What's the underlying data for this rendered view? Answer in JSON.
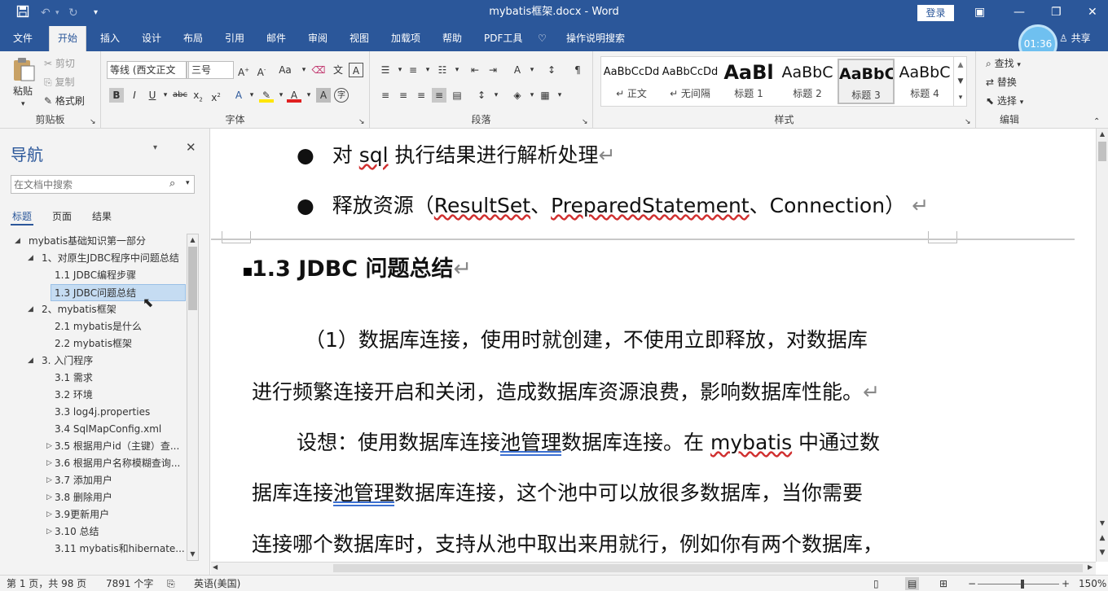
{
  "titlebar": {
    "title": "mybatis框架.docx  -  Word",
    "login": "登录"
  },
  "tabs": [
    "文件",
    "开始",
    "插入",
    "设计",
    "布局",
    "引用",
    "邮件",
    "审阅",
    "视图",
    "加载项",
    "帮助",
    "PDF工具",
    "操作说明搜索"
  ],
  "timer": "01:36",
  "share": "共享",
  "ribbon": {
    "clipboard": {
      "paste": "粘贴",
      "cut": "剪切",
      "copy": "复制",
      "format_painter": "格式刷",
      "label": "剪贴板"
    },
    "font": {
      "name": "等线 (西文正文",
      "size": "三号",
      "aa": "Aa",
      "label": "字体"
    },
    "paragraph": {
      "label": "段落"
    },
    "styles": {
      "label": "样式",
      "items": [
        {
          "preview": "AaBbCcDd",
          "name": "↵ 正文"
        },
        {
          "preview": "AaBbCcDd",
          "name": "↵ 无间隔"
        },
        {
          "preview": "AaBl",
          "name": "标题 1"
        },
        {
          "preview": "AaBbC",
          "name": "标题 2"
        },
        {
          "preview": "AaBbC",
          "name": "标题 3"
        },
        {
          "preview": "AaBbC",
          "name": "标题 4"
        }
      ]
    },
    "editing": {
      "find": "查找",
      "replace": "替换",
      "select": "选择",
      "label": "编辑"
    }
  },
  "nav": {
    "title": "导航",
    "search_placeholder": "在文档中搜索",
    "tabs": [
      "标题",
      "页面",
      "结果"
    ],
    "tree": [
      {
        "label": "mybatis基础知识第一部分",
        "level": 0,
        "toggle": "◢"
      },
      {
        "label": "1、对原生JDBC程序中问题总结",
        "level": 1,
        "toggle": "◢"
      },
      {
        "label": "1.1 JDBC编程步骤",
        "level": 2,
        "toggle": ""
      },
      {
        "label": "1.3 JDBC问题总结",
        "level": 2,
        "toggle": "",
        "selected": true
      },
      {
        "label": "2、mybatis框架",
        "level": 1,
        "toggle": "◢"
      },
      {
        "label": "2.1 mybatis是什么",
        "level": 2,
        "toggle": ""
      },
      {
        "label": "2.2 mybatis框架",
        "level": 2,
        "toggle": ""
      },
      {
        "label": "3. 入门程序",
        "level": 1,
        "toggle": "◢"
      },
      {
        "label": "3.1 需求",
        "level": 2,
        "toggle": ""
      },
      {
        "label": "3.2 环境",
        "level": 2,
        "toggle": ""
      },
      {
        "label": "3.3 log4j.properties",
        "level": 2,
        "toggle": ""
      },
      {
        "label": "3.4 SqlMapConfig.xml",
        "level": 2,
        "toggle": ""
      },
      {
        "label": "3.5 根据用户id（主键）查...",
        "level": 2,
        "toggle": "▷"
      },
      {
        "label": "3.6 根据用户名称模糊查询...",
        "level": 2,
        "toggle": "▷"
      },
      {
        "label": "3.7 添加用户",
        "level": 2,
        "toggle": "▷"
      },
      {
        "label": "3.8 删除用户",
        "level": 2,
        "toggle": "▷"
      },
      {
        "label": "3.9更新用户",
        "level": 2,
        "toggle": "▷"
      },
      {
        "label": "3.10 总结",
        "level": 2,
        "toggle": "▷"
      },
      {
        "label": "3.11 mybatis和hibernate...",
        "level": 2,
        "toggle": ""
      }
    ]
  },
  "doc": {
    "bullet1": {
      "a": "对 ",
      "b": "sql",
      "c": " 执行结果进行解析处理"
    },
    "bullet2": {
      "a": "释放资源（",
      "b": "ResultSet",
      "c": "、",
      "d": "PreparedStatement",
      "e": "、Connection）"
    },
    "heading": "1.3 JDBC 问题总结",
    "para1_line1": "（1）数据库连接，使用时就创建，不使用立即释放，对数据库",
    "para1_line2": "进行频繁连接开启和关闭，造成数据库资源浪费，影响数据库性能。",
    "para2_line1": {
      "a": "设想：使用数据库连接",
      "b": "池管理",
      "c": "数据库连接。在 ",
      "d": "mybatis",
      "e": " 中通过数"
    },
    "para2_line2": {
      "a": "据库连接",
      "b": "池管理",
      "c": "数据库连接，这个池中可以放很多数据库，当你需要"
    },
    "para2_line3": "连接哪个数据库时，支持从池中取出来用就行，例如你有两个数据库，",
    "para_mark": "↵"
  },
  "status": {
    "page": "第 1 页，共 98 页",
    "words": "7891 个字",
    "lang": "英语(美国)",
    "zoom": "150%"
  }
}
